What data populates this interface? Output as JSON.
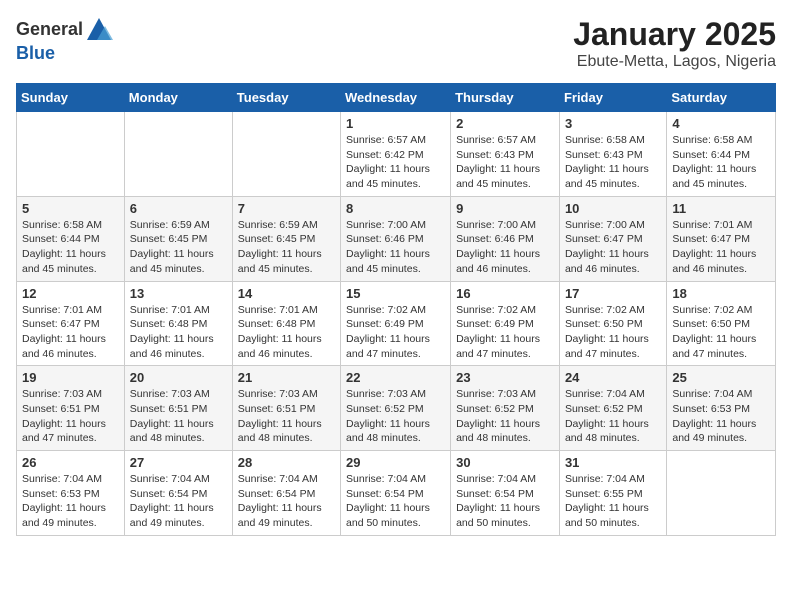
{
  "logo": {
    "general": "General",
    "blue": "Blue"
  },
  "header": {
    "month": "January 2025",
    "location": "Ebute-Metta, Lagos, Nigeria"
  },
  "weekdays": [
    "Sunday",
    "Monday",
    "Tuesday",
    "Wednesday",
    "Thursday",
    "Friday",
    "Saturday"
  ],
  "weeks": [
    [
      {
        "day": "",
        "sunrise": "",
        "sunset": "",
        "daylight": ""
      },
      {
        "day": "",
        "sunrise": "",
        "sunset": "",
        "daylight": ""
      },
      {
        "day": "",
        "sunrise": "",
        "sunset": "",
        "daylight": ""
      },
      {
        "day": "1",
        "sunrise": "Sunrise: 6:57 AM",
        "sunset": "Sunset: 6:42 PM",
        "daylight": "Daylight: 11 hours and 45 minutes."
      },
      {
        "day": "2",
        "sunrise": "Sunrise: 6:57 AM",
        "sunset": "Sunset: 6:43 PM",
        "daylight": "Daylight: 11 hours and 45 minutes."
      },
      {
        "day": "3",
        "sunrise": "Sunrise: 6:58 AM",
        "sunset": "Sunset: 6:43 PM",
        "daylight": "Daylight: 11 hours and 45 minutes."
      },
      {
        "day": "4",
        "sunrise": "Sunrise: 6:58 AM",
        "sunset": "Sunset: 6:44 PM",
        "daylight": "Daylight: 11 hours and 45 minutes."
      }
    ],
    [
      {
        "day": "5",
        "sunrise": "Sunrise: 6:58 AM",
        "sunset": "Sunset: 6:44 PM",
        "daylight": "Daylight: 11 hours and 45 minutes."
      },
      {
        "day": "6",
        "sunrise": "Sunrise: 6:59 AM",
        "sunset": "Sunset: 6:45 PM",
        "daylight": "Daylight: 11 hours and 45 minutes."
      },
      {
        "day": "7",
        "sunrise": "Sunrise: 6:59 AM",
        "sunset": "Sunset: 6:45 PM",
        "daylight": "Daylight: 11 hours and 45 minutes."
      },
      {
        "day": "8",
        "sunrise": "Sunrise: 7:00 AM",
        "sunset": "Sunset: 6:46 PM",
        "daylight": "Daylight: 11 hours and 45 minutes."
      },
      {
        "day": "9",
        "sunrise": "Sunrise: 7:00 AM",
        "sunset": "Sunset: 6:46 PM",
        "daylight": "Daylight: 11 hours and 46 minutes."
      },
      {
        "day": "10",
        "sunrise": "Sunrise: 7:00 AM",
        "sunset": "Sunset: 6:47 PM",
        "daylight": "Daylight: 11 hours and 46 minutes."
      },
      {
        "day": "11",
        "sunrise": "Sunrise: 7:01 AM",
        "sunset": "Sunset: 6:47 PM",
        "daylight": "Daylight: 11 hours and 46 minutes."
      }
    ],
    [
      {
        "day": "12",
        "sunrise": "Sunrise: 7:01 AM",
        "sunset": "Sunset: 6:47 PM",
        "daylight": "Daylight: 11 hours and 46 minutes."
      },
      {
        "day": "13",
        "sunrise": "Sunrise: 7:01 AM",
        "sunset": "Sunset: 6:48 PM",
        "daylight": "Daylight: 11 hours and 46 minutes."
      },
      {
        "day": "14",
        "sunrise": "Sunrise: 7:01 AM",
        "sunset": "Sunset: 6:48 PM",
        "daylight": "Daylight: 11 hours and 46 minutes."
      },
      {
        "day": "15",
        "sunrise": "Sunrise: 7:02 AM",
        "sunset": "Sunset: 6:49 PM",
        "daylight": "Daylight: 11 hours and 47 minutes."
      },
      {
        "day": "16",
        "sunrise": "Sunrise: 7:02 AM",
        "sunset": "Sunset: 6:49 PM",
        "daylight": "Daylight: 11 hours and 47 minutes."
      },
      {
        "day": "17",
        "sunrise": "Sunrise: 7:02 AM",
        "sunset": "Sunset: 6:50 PM",
        "daylight": "Daylight: 11 hours and 47 minutes."
      },
      {
        "day": "18",
        "sunrise": "Sunrise: 7:02 AM",
        "sunset": "Sunset: 6:50 PM",
        "daylight": "Daylight: 11 hours and 47 minutes."
      }
    ],
    [
      {
        "day": "19",
        "sunrise": "Sunrise: 7:03 AM",
        "sunset": "Sunset: 6:51 PM",
        "daylight": "Daylight: 11 hours and 47 minutes."
      },
      {
        "day": "20",
        "sunrise": "Sunrise: 7:03 AM",
        "sunset": "Sunset: 6:51 PM",
        "daylight": "Daylight: 11 hours and 48 minutes."
      },
      {
        "day": "21",
        "sunrise": "Sunrise: 7:03 AM",
        "sunset": "Sunset: 6:51 PM",
        "daylight": "Daylight: 11 hours and 48 minutes."
      },
      {
        "day": "22",
        "sunrise": "Sunrise: 7:03 AM",
        "sunset": "Sunset: 6:52 PM",
        "daylight": "Daylight: 11 hours and 48 minutes."
      },
      {
        "day": "23",
        "sunrise": "Sunrise: 7:03 AM",
        "sunset": "Sunset: 6:52 PM",
        "daylight": "Daylight: 11 hours and 48 minutes."
      },
      {
        "day": "24",
        "sunrise": "Sunrise: 7:04 AM",
        "sunset": "Sunset: 6:52 PM",
        "daylight": "Daylight: 11 hours and 48 minutes."
      },
      {
        "day": "25",
        "sunrise": "Sunrise: 7:04 AM",
        "sunset": "Sunset: 6:53 PM",
        "daylight": "Daylight: 11 hours and 49 minutes."
      }
    ],
    [
      {
        "day": "26",
        "sunrise": "Sunrise: 7:04 AM",
        "sunset": "Sunset: 6:53 PM",
        "daylight": "Daylight: 11 hours and 49 minutes."
      },
      {
        "day": "27",
        "sunrise": "Sunrise: 7:04 AM",
        "sunset": "Sunset: 6:54 PM",
        "daylight": "Daylight: 11 hours and 49 minutes."
      },
      {
        "day": "28",
        "sunrise": "Sunrise: 7:04 AM",
        "sunset": "Sunset: 6:54 PM",
        "daylight": "Daylight: 11 hours and 49 minutes."
      },
      {
        "day": "29",
        "sunrise": "Sunrise: 7:04 AM",
        "sunset": "Sunset: 6:54 PM",
        "daylight": "Daylight: 11 hours and 50 minutes."
      },
      {
        "day": "30",
        "sunrise": "Sunrise: 7:04 AM",
        "sunset": "Sunset: 6:54 PM",
        "daylight": "Daylight: 11 hours and 50 minutes."
      },
      {
        "day": "31",
        "sunrise": "Sunrise: 7:04 AM",
        "sunset": "Sunset: 6:55 PM",
        "daylight": "Daylight: 11 hours and 50 minutes."
      },
      {
        "day": "",
        "sunrise": "",
        "sunset": "",
        "daylight": ""
      }
    ]
  ]
}
